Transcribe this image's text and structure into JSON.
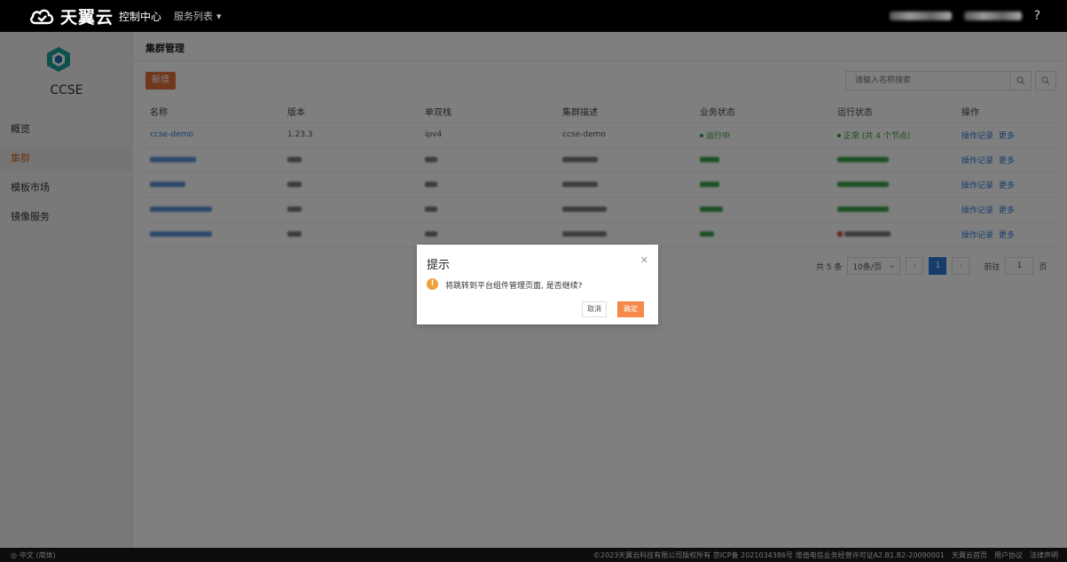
{
  "topbar": {
    "brand": "天翼云",
    "console": "控制中心",
    "service_list": "服务列表",
    "help": "?"
  },
  "sidebar": {
    "product": "CCSE",
    "items": [
      {
        "label": "概览",
        "active": false
      },
      {
        "label": "集群",
        "active": true
      },
      {
        "label": "模板市场",
        "active": false
      },
      {
        "label": "镜像服务",
        "active": false
      }
    ]
  },
  "main": {
    "breadcrumb": "集群管理",
    "new_button": "新增",
    "search_placeholder": "请输入名称搜索",
    "columns": [
      "名称",
      "版本",
      "单双栈",
      "集群描述",
      "业务状态",
      "运行状态",
      "操作"
    ],
    "rows": [
      {
        "name": "ccse-demo",
        "version": "1.23.3",
        "stack": "ipv4",
        "desc": "ccse-demo",
        "biz": "运行中",
        "run": "正常 (共 4 个节点)",
        "op1": "操作记录",
        "op2": "更多"
      },
      {
        "op1": "操作记录",
        "op2": "更多"
      },
      {
        "op1": "操作记录",
        "op2": "更多"
      },
      {
        "op1": "操作记录",
        "op2": "更多"
      },
      {
        "op1": "操作记录",
        "op2": "更多"
      }
    ],
    "pager": {
      "total": "共 5 条",
      "page_size": "10条/页",
      "current": "1",
      "goto_label": "前往",
      "goto_value": "1",
      "page_unit": "页"
    }
  },
  "dialog": {
    "title": "提示",
    "message": "将跳转到平台组件管理页面, 是否继续?",
    "cancel": "取消",
    "confirm": "确定"
  },
  "footer": {
    "language": "中文 (简体)",
    "copyright": "©2023天翼云科技有限公司版权所有 京ICP备 2021034386号 增值电信业务经营许可证A2.B1.B2-20090001",
    "links": [
      "天翼云首页",
      "用户协议",
      "法律声明"
    ]
  },
  "colors": {
    "accent": "#e0703a",
    "link": "#2a7bd8",
    "success": "#2f9d3a",
    "warning": "#f0a03a"
  }
}
